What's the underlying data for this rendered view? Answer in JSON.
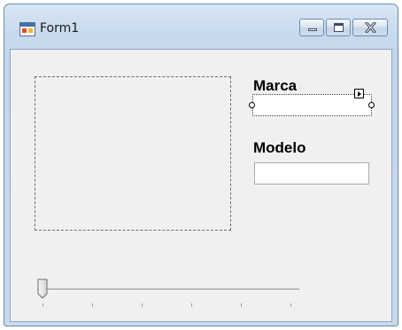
{
  "window": {
    "title": "Form1"
  },
  "form": {
    "marca_label": "Marca",
    "marca_value": "",
    "modelo_label": "Modelo",
    "modelo_value": ""
  },
  "trackbar": {
    "value": 0,
    "minimum": 0,
    "maximum": 10,
    "tick_count": 6
  },
  "icons": {
    "app": "winforms-app-icon",
    "minimize": "minimize-icon",
    "maximize": "maximize-icon",
    "close": "close-icon",
    "smart_tag": "smart-tag-arrow-icon"
  },
  "colors": {
    "client_background": "#f0f0f0",
    "titlebar_glass": "#c9dbee"
  }
}
